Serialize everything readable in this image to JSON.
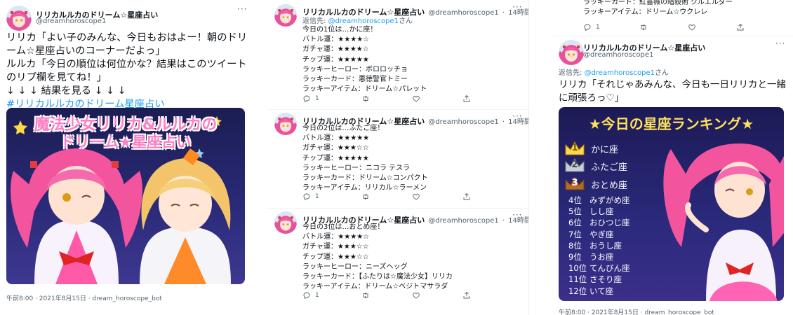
{
  "account": {
    "name": "リリカルルカのドリーム☆星座占い",
    "handle": "@dreamhoroscope1",
    "time_ago": "14時間"
  },
  "icons": {
    "more": "more-icon",
    "reply": "reply-icon",
    "retweet": "retweet-icon",
    "like": "heart-icon",
    "share": "share-icon"
  },
  "colors": {
    "link": "#1d9bf0",
    "muted": "#536471"
  },
  "col1": {
    "lines": [
      "リリカ「よい子のみんな、今日もおはよー！朝のドリ",
      "ーム☆星座占いのコーナーだよっ」",
      "ルルカ「今日の順位は何位かな？結果はこのツイート",
      "のリプ欄を見てね！」",
      "↓ ↓ ↓ 結果を見る ↓ ↓ ↓"
    ],
    "hashtag": "#リリカルルカのドリーム星座占い",
    "image_title_1": "魔法少女リリカ&ルルカの",
    "image_title_2": "ドリーム★星座占い",
    "meta": "午前8:00 · 2021年8月15日 · dream_horoscope_bot"
  },
  "col2": {
    "reply_prefix": "返信先: ",
    "reply_handle": "@dreamhoroscope1",
    "reply_suffix": "さん",
    "tweets": [
      {
        "lines": [
          "今日の1位は…かに座！",
          "バトル運：★★★★☆",
          "ガチャ運：★★★★☆",
          "チップ運：★★★★★",
          "ラッキーヒーロー：ボロロッチョ",
          "ラッキーカード：悪徳警官トミー",
          "ラッキーアイテム：ドリーム☆パレット"
        ],
        "reply_count": "1"
      },
      {
        "lines": [
          "今日の2位は…ふたご座！",
          "バトル運：★★★★★",
          "ガチャ運：★★★☆☆",
          "チップ運：★★★★★",
          "ラッキーヒーロー：ニコラ テスラ",
          "ラッキーカード：ドリーム☆コンパクト",
          "ラッキーアイテム：リリカル☆ラーメン"
        ],
        "reply_count": "1"
      },
      {
        "lines": [
          "今日の3位は…おとめ座！",
          "バトル運：★★★★☆",
          "ガチャ運：★★★☆☆",
          "チップ運：★★★☆☆",
          "ラッキーヒーロー：ニーズヘッグ",
          "ラッキーカード：【ふたりは☆魔法少女】リリカ",
          "ラッキーアイテム：ドリーム☆ベジトマサラダ"
        ],
        "reply_count": "1"
      }
    ]
  },
  "col3": {
    "top_lines": [
      "ラッキーカード：紅薔薇の暗殺術 クルエルダー",
      "ラッキーアイテム：ドリーム☆ウクレレ"
    ],
    "top_reply_count": "1",
    "reply_prefix": "返信先: ",
    "reply_handle": "@dreamhoroscope1",
    "reply_suffix": "さん",
    "lines": [
      "リリカ「それじゃあみんな、今日も一日リリカと一緒",
      "に頑張ろっ♡」"
    ],
    "ranking_title": "★今日の星座ランキング★",
    "top3": [
      {
        "rank": "1",
        "sign": "かに座"
      },
      {
        "rank": "2",
        "sign": "ふたご座"
      },
      {
        "rank": "3",
        "sign": "おとめ座"
      }
    ],
    "rest": [
      {
        "rank": "4位",
        "sign": "みずがめ座"
      },
      {
        "rank": "5位",
        "sign": "しし座"
      },
      {
        "rank": "6位",
        "sign": "おひつじ座"
      },
      {
        "rank": "7位",
        "sign": "やぎ座"
      },
      {
        "rank": "8位",
        "sign": "おうし座"
      },
      {
        "rank": "9位",
        "sign": "うお座"
      },
      {
        "rank": "10位",
        "sign": "てんびん座"
      },
      {
        "rank": "11位",
        "sign": "さそり座"
      },
      {
        "rank": "12位",
        "sign": "いて座"
      }
    ],
    "meta": "午前8:00 · 2021年8月15日 · dream_horoscope_bot"
  }
}
